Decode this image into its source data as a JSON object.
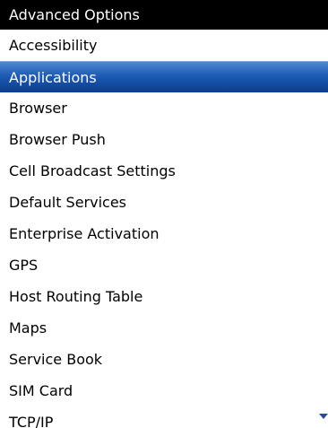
{
  "header": {
    "title": "Advanced Options"
  },
  "options": {
    "items": [
      {
        "label": "Accessibility"
      },
      {
        "label": "Applications",
        "selected": true
      },
      {
        "label": "Browser"
      },
      {
        "label": "Browser Push"
      },
      {
        "label": "Cell Broadcast Settings"
      },
      {
        "label": "Default Services"
      },
      {
        "label": "Enterprise Activation"
      },
      {
        "label": "GPS"
      },
      {
        "label": "Host Routing Table"
      },
      {
        "label": "Maps"
      },
      {
        "label": "Service Book"
      },
      {
        "label": "SIM Card"
      },
      {
        "label": "TCP/IP"
      }
    ]
  },
  "scroll_indicator": {
    "icon": "scroll-down-arrow-icon",
    "color": "#1f4e9e"
  },
  "colors": {
    "title_bar_bg": "#000000",
    "title_bar_text": "#ffffff",
    "selection_bg": "#1d5bb4",
    "selection_text": "#ffffff"
  }
}
